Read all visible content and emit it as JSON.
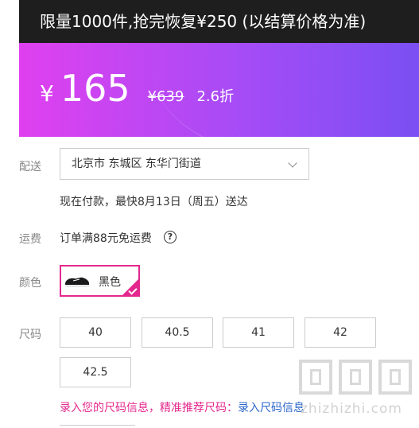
{
  "promo_banner": {
    "text": "限量1000件,抢完恢复¥250 (以结算价格为准)"
  },
  "price": {
    "currency": "¥",
    "current": "165",
    "original": "¥639",
    "discount": "2.6折"
  },
  "delivery": {
    "label": "配送",
    "address": "北京市 东城区 东华门街道",
    "eta": "现在付款，最快8月13日（周五）送达"
  },
  "shipping": {
    "label": "运费",
    "text": "订单满88元免运费",
    "help_glyph": "?"
  },
  "color": {
    "label": "颜色",
    "selected": "黑色"
  },
  "size": {
    "label": "尺码",
    "options": [
      "40",
      "40.5",
      "41",
      "42",
      "42.5"
    ],
    "hint_pink": "录入您的尺码信息，精准推荐尺码：",
    "hint_link": "录入尺码信息"
  },
  "watermark": {
    "text": "zhizhizhi.com"
  },
  "colors": {
    "accent": "#e4288e",
    "link": "#2b66c9",
    "gradient_start": "#e040ef",
    "gradient_end": "#7a4ff3"
  }
}
